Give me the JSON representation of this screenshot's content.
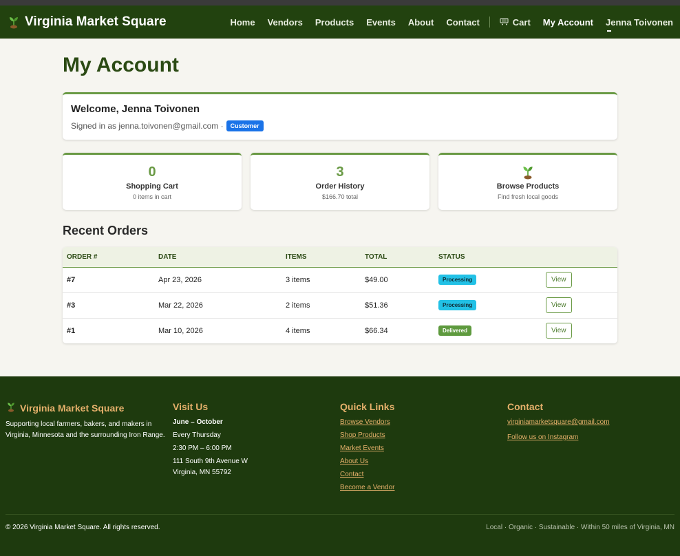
{
  "brand": {
    "name": "Virginia Market Square",
    "icon": "sprout-icon"
  },
  "nav": {
    "items": [
      "Home",
      "Vendors",
      "Products",
      "Events",
      "About",
      "Contact"
    ],
    "cart_label": "Cart",
    "account_label": "My Account",
    "user_label": "Jenna Toivonen"
  },
  "page": {
    "title": "My Account"
  },
  "welcome": {
    "title": "Welcome, Jenna Toivonen",
    "signed_in_prefix": "Signed in as jenna.toivonen@gmail.com ·",
    "role_badge": "Customer"
  },
  "stats": [
    {
      "value": "0",
      "label": "Shopping Cart",
      "sub": "0 items in cart"
    },
    {
      "value": "3",
      "label": "Order History",
      "sub": "$166.70 total"
    },
    {
      "icon": "sprout-icon",
      "label": "Browse Products",
      "sub": "Find fresh local goods"
    }
  ],
  "orders": {
    "title": "Recent Orders",
    "columns": [
      "ORDER #",
      "DATE",
      "ITEMS",
      "TOTAL",
      "STATUS",
      ""
    ],
    "rows": [
      {
        "num": "#7",
        "date": "Apr 23, 2026",
        "items": "3 items",
        "total": "$49.00",
        "status": "Processing",
        "action": "View"
      },
      {
        "num": "#3",
        "date": "Mar 22, 2026",
        "items": "2 items",
        "total": "$51.36",
        "status": "Processing",
        "action": "View"
      },
      {
        "num": "#1",
        "date": "Mar 10, 2026",
        "items": "4 items",
        "total": "$66.34",
        "status": "Delivered",
        "action": "View"
      }
    ]
  },
  "footer": {
    "about": {
      "title": "Virginia Market Square",
      "text": "Supporting local farmers, bakers, and makers in Virginia, Minnesota and the surrounding Iron Range."
    },
    "visit": {
      "title": "Visit Us",
      "season": "June – October",
      "day": "Every Thursday",
      "hours": "2:30 PM – 6:00 PM",
      "address1": "111 South 9th Avenue W",
      "address2": "Virginia, MN 55792"
    },
    "links": {
      "title": "Quick Links",
      "items": [
        "Browse Vendors",
        "Shop Products",
        "Market Events",
        "About Us",
        "Contact",
        "Become a Vendor"
      ]
    },
    "contact": {
      "title": "Contact",
      "email": "virginiamarketsquare@gmail.com",
      "instagram": "Follow us on Instagram"
    },
    "copyright": "© 2026 Virginia Market Square. All rights reserved.",
    "tagline": "Local · Organic · Sustainable · Within 50 miles of Virginia, MN"
  },
  "colors": {
    "nav_bg": "#22420f",
    "footer_bg": "#1e3a0e",
    "accent_green": "#6a9a45",
    "footer_accent": "#e5b06b",
    "badge_blue": "#1a73e8",
    "processing": "#22c1e6",
    "delivered": "#5e9a3e"
  }
}
